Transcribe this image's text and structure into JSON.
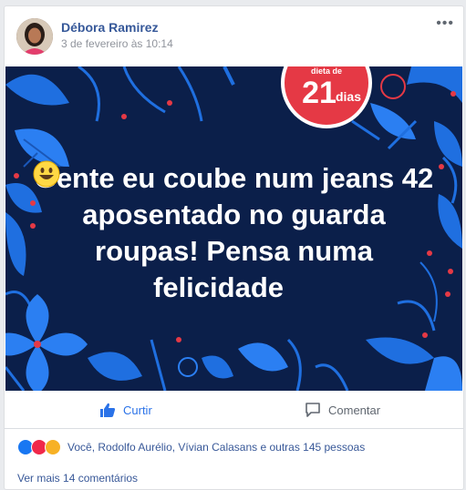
{
  "post": {
    "author": "Débora Ramirez",
    "timestamp": "3 de fevereiro às 10:14",
    "image": {
      "text_lines": [
        "Gente eu coube num jeans 42",
        "aposentado no guarda",
        "roupas! Pensa numa",
        "felicidade"
      ],
      "logo_small": "dieta de",
      "logo_number": "21",
      "logo_word": "dias",
      "background_color": "#0b1f4a",
      "accent_blue": "#1f6fe0",
      "accent_red": "#e53945"
    }
  },
  "actions": {
    "like_label": "Curtir",
    "comment_label": "Comentar"
  },
  "reactions": {
    "icons": [
      "like",
      "love",
      "wow"
    ],
    "summary": "Você, Rodolfo Aurélio, Vívian Calasans e outras 145 pessoas"
  },
  "comments": {
    "see_more": "Ver mais 14 comentários"
  },
  "colors": {
    "link": "#365899",
    "muted": "#90949c"
  }
}
